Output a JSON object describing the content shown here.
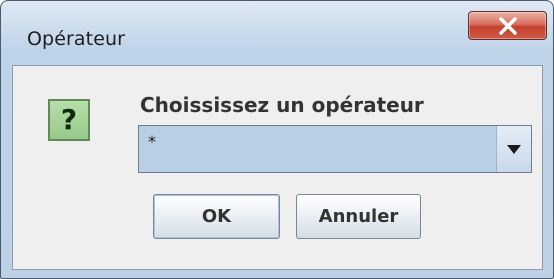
{
  "window": {
    "title": "Opérateur",
    "close_icon": "close-x-icon"
  },
  "dialog": {
    "icon": "question-icon",
    "icon_glyph": "?",
    "prompt": "Choississez un opérateur",
    "operator_select": {
      "selected": "*",
      "arrow_icon": "dropdown-arrow-icon"
    },
    "buttons": {
      "ok": "OK",
      "cancel": "Annuler"
    }
  },
  "colors": {
    "title_bar": "#c8d9ec",
    "close_button": "#c8462f",
    "client_background": "#efefef",
    "combo_selection": "#b8cfe5",
    "question_icon": "#a7d59a"
  }
}
